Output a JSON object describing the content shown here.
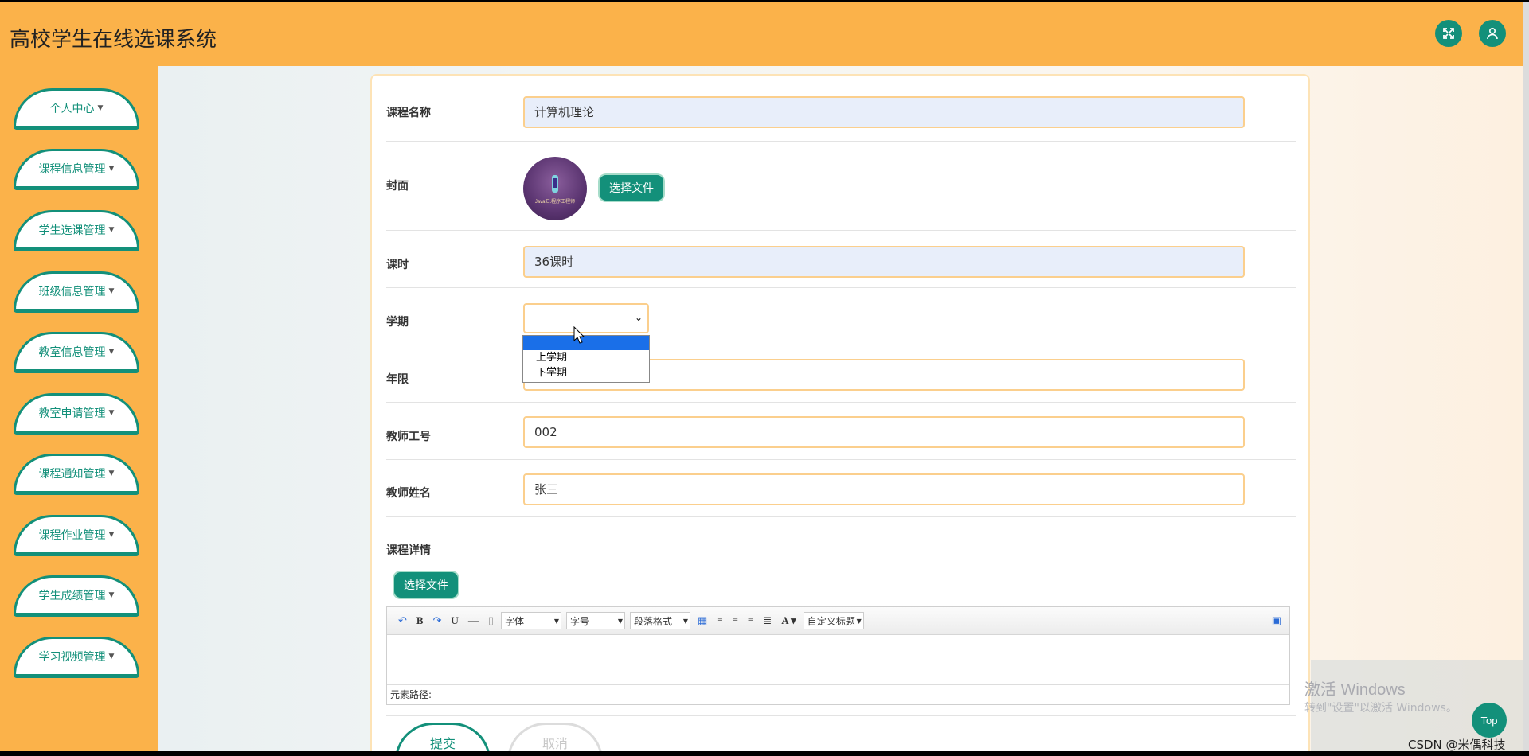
{
  "app": {
    "title": "高校学生在线选课系统"
  },
  "header": {
    "fullscreen_icon": "expand-icon",
    "user_icon": "user-icon"
  },
  "sidebar": {
    "items": [
      {
        "label": "个人中心"
      },
      {
        "label": "课程信息管理"
      },
      {
        "label": "学生选课管理"
      },
      {
        "label": "班级信息管理"
      },
      {
        "label": "教室信息管理"
      },
      {
        "label": "教室申请管理"
      },
      {
        "label": "课程通知管理"
      },
      {
        "label": "课程作业管理"
      },
      {
        "label": "学生成绩管理"
      },
      {
        "label": "学习视频管理"
      }
    ]
  },
  "form": {
    "course_name": {
      "label": "课程名称",
      "value": "计算机理论"
    },
    "cover": {
      "label": "封面",
      "button": "选择文件",
      "image_caption": "Java汇.程序工程师"
    },
    "hours": {
      "label": "课时",
      "value": "36课时"
    },
    "semester": {
      "label": "学期",
      "value": "",
      "options": [
        "",
        "上学期",
        "下学期"
      ]
    },
    "years": {
      "label": "年限",
      "value": ""
    },
    "teacher_id": {
      "label": "教师工号",
      "value": "002"
    },
    "teacher_name": {
      "label": "教师姓名",
      "value": "张三"
    },
    "details": {
      "label": "课程详情",
      "button": "选择文件",
      "toolbar": {
        "font": "字体",
        "size": "字号",
        "paragraph": "段落格式",
        "custom_title": "自定义标题"
      },
      "path_label": "元素路径:"
    },
    "submit": "提交",
    "cancel": "取消"
  },
  "overlays": {
    "windows_activate_title": "激活 Windows",
    "windows_activate_sub": "转到\"设置\"以激活 Windows。",
    "top_button": "Top",
    "watermark": "CSDN @米偶科技"
  },
  "colors": {
    "header": "#fbb24a",
    "accent": "#13907a",
    "field_border": "#fbcf8d"
  }
}
